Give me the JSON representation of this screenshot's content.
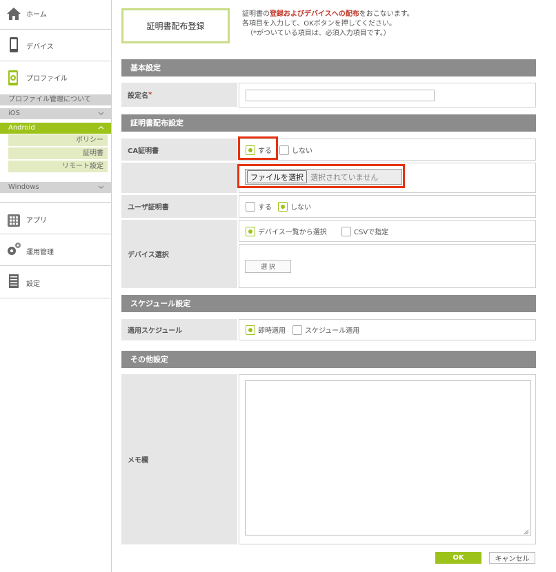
{
  "sidebar": {
    "home_label": "ホーム",
    "device_label": "デバイス",
    "profile_label": "プロファイル",
    "profile_sub": {
      "about": "プロファイル管理について",
      "ios": "iOS",
      "android": "Android",
      "android_items": [
        "ポリシー",
        "証明書",
        "リモート設定"
      ],
      "windows": "Windows"
    },
    "app_label": "アプリ",
    "ops_label": "運用管理",
    "settings_label": "設定"
  },
  "page": {
    "title": "証明書配布登録",
    "intro_line1_pre": "証明書の",
    "intro_line1_em": "登録およびデバイスへの配布",
    "intro_line1_post": "をおこないます。",
    "intro_line2": "各項目を入力して、OKボタンを押してください。",
    "intro_line3": "（*がついている項目は、必須入力項目です。）"
  },
  "sections": {
    "basic": "基本設定",
    "distribution": "証明書配布設定",
    "schedule": "スケジュール設定",
    "other": "その他設定"
  },
  "fields": {
    "setting_name_label": "設定名",
    "required_mark": "*",
    "setting_name_value": "",
    "ca_cert_label": "CA証明書",
    "ca_yes": "する",
    "ca_no": "しない",
    "file_button": "ファイルを選択",
    "file_status": "選択されていません",
    "user_cert_label": "ユーザ証明書",
    "user_yes": "する",
    "user_no": "しない",
    "device_select_label": "デバイス選択",
    "device_from_list": "デバイス一覧から選択",
    "device_csv": "CSVで指定",
    "select_button": "選 択",
    "schedule_label": "適用スケジュール",
    "schedule_now": "即時適用",
    "schedule_scheduled": "スケジュール適用",
    "memo_label": "メモ欄",
    "memo_value": ""
  },
  "state": {
    "ca_cert": "yes",
    "user_cert": "no",
    "device_select": "list",
    "schedule": "now"
  },
  "buttons": {
    "ok": "OK",
    "cancel": "キャンセル"
  },
  "colors": {
    "accent": "#9dc21a",
    "section_header": "#8c8c8c",
    "highlight": "#e53312",
    "required": "#c0392b"
  }
}
